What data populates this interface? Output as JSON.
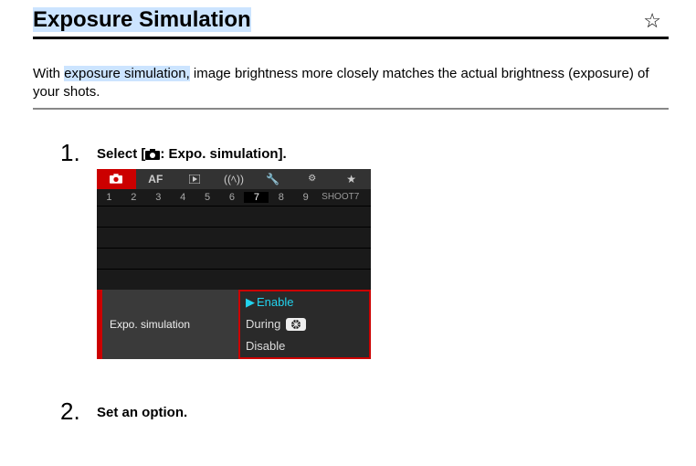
{
  "header": {
    "title_pre": "Exposure Simulation",
    "star": "☆"
  },
  "intro": {
    "pre": "With ",
    "hl": "exposure simulation,",
    "post": " image brightness more closely matches the actual brightness (exposure) of your shots."
  },
  "steps": {
    "s1": {
      "title_pre": "Select [",
      "title_post": ": Expo. simulation]."
    },
    "s2": {
      "title": "Set an option."
    }
  },
  "menu": {
    "tabs": {
      "af": "AF"
    },
    "nums": [
      "1",
      "2",
      "3",
      "4",
      "5",
      "6",
      "7",
      "8",
      "9"
    ],
    "nums_label": "SHOOT7",
    "row_label": "Expo. simulation",
    "options": {
      "enable": "Enable",
      "during": "During",
      "disable": "Disable"
    }
  }
}
